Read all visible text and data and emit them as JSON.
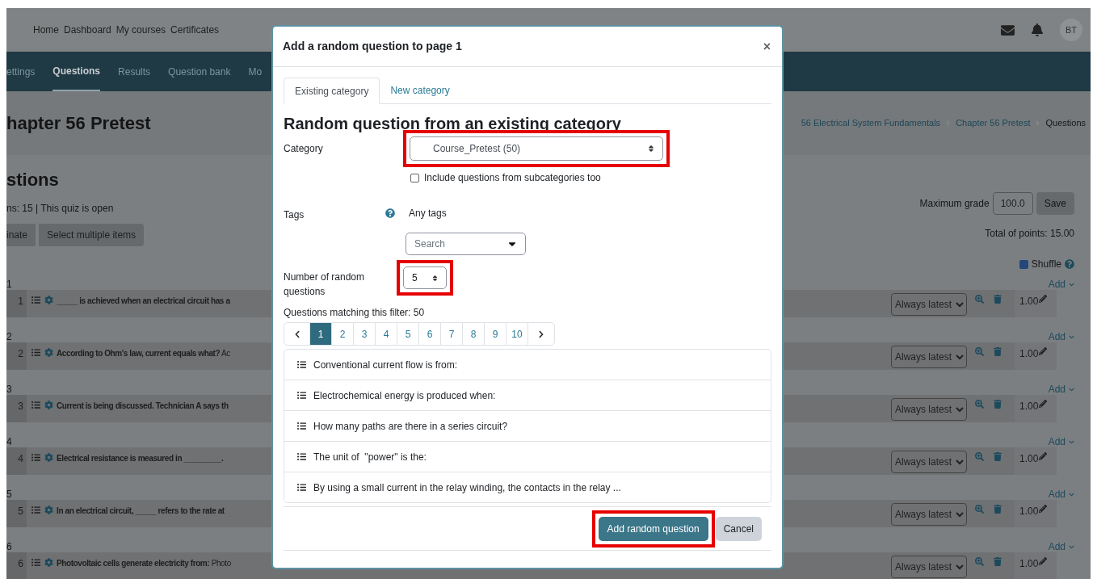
{
  "top_nav": {
    "links": [
      "Home",
      "Dashboard",
      "My courses",
      "Certificates"
    ],
    "avatar": "BT"
  },
  "course_nav": [
    {
      "label": "ettings",
      "selected": false
    },
    {
      "label": "Questions",
      "selected": true
    },
    {
      "label": "Results",
      "selected": false
    },
    {
      "label": "Question bank",
      "selected": false
    },
    {
      "label": "Mo",
      "selected": false
    }
  ],
  "page_title": "hapter 56 Pretest",
  "breadcrumb": [
    "56 Electrical System Fundamentals",
    "Chapter 56 Pretest",
    "Questions"
  ],
  "section_title": "stions",
  "quiz_info": "ns: 15 | This quiz is open",
  "toolbar_buttons": [
    "inate",
    "Select multiple items"
  ],
  "max_grade": {
    "label": "Maximum grade",
    "value": "100.0",
    "button": "Save"
  },
  "total_points": "Total of points: 15.00",
  "shuffle": {
    "label": "Shuffle",
    "checked": true
  },
  "pages": [
    {
      "label": "1",
      "add": "Add",
      "question": {
        "number": "1",
        "title": "_____ is achieved when an electrical circuit has a",
        "version": "Always latest",
        "mark": "1.00"
      }
    },
    {
      "label": "2",
      "add": "Add",
      "question": {
        "number": "2",
        "title": "According to Ohm's law, current equals what?",
        "text": "Ac",
        "version": "Always latest",
        "mark": "1.00"
      }
    },
    {
      "label": "3",
      "add": "Add",
      "question": {
        "number": "3",
        "title": "Current is being discussed. Technician A says th",
        "version": "Always latest",
        "mark": "1.00"
      }
    },
    {
      "label": "4",
      "add": "Add",
      "question": {
        "number": "4",
        "title": "Electrical resistance is measured in _________.",
        "version": "Always latest",
        "mark": "1.00"
      }
    },
    {
      "label": "5",
      "add": "Add",
      "question": {
        "number": "5",
        "title": "In an electrical circuit, _____ refers to the rate at",
        "version": "Always latest",
        "mark": "1.00"
      }
    },
    {
      "label": "6",
      "add": "Add",
      "question": {
        "number": "6",
        "title": "Photovoltaic cells generate electricity from:",
        "text": "Photo",
        "version": "Always latest",
        "mark": "1.00"
      }
    }
  ],
  "modal": {
    "title": "Add a random question to page 1",
    "close": "×",
    "tabs": [
      {
        "label": "Existing category",
        "selected": true
      },
      {
        "label": "New category",
        "selected": false
      }
    ],
    "heading": "Random question from an existing category",
    "category": {
      "label": "Category",
      "value": "Course_Pretest (50)",
      "highlighted": true
    },
    "subcategories": {
      "label": "Include questions from subcategories too",
      "checked": false
    },
    "tags": {
      "label": "Tags",
      "value": "Any tags",
      "placeholder": "Search"
    },
    "number": {
      "label": "Number of random questions",
      "value": "5",
      "highlighted": true
    },
    "matching": "Questions matching this filter: 50",
    "pagination": [
      {
        "label": "1",
        "selected": true
      },
      {
        "label": "2",
        "selected": false
      },
      {
        "label": "3",
        "selected": false
      },
      {
        "label": "4",
        "selected": false
      },
      {
        "label": "5",
        "selected": false
      },
      {
        "label": "6",
        "selected": false
      },
      {
        "label": "7",
        "selected": false
      },
      {
        "label": "8",
        "selected": false
      },
      {
        "label": "9",
        "selected": false
      },
      {
        "label": "10",
        "selected": false
      }
    ],
    "questions": [
      "Conventional current flow is from:",
      "Electrochemical energy is produced when:",
      "How many paths are there in a series circuit?",
      "The unit of  \"power\" is the:",
      "By using a small current in the relay winding, the contacts in the relay ..."
    ],
    "buttons": [
      {
        "label": "Add random question",
        "kind": "primary",
        "highlighted": true
      },
      {
        "label": "Cancel",
        "kind": "secondary",
        "highlighted": false
      }
    ]
  }
}
